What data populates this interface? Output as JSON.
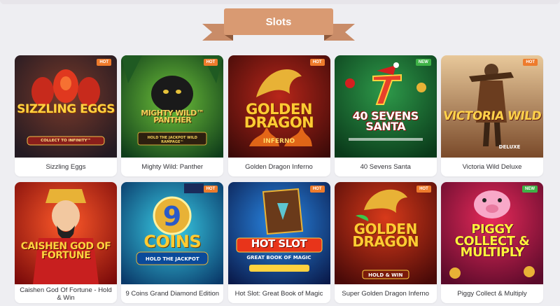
{
  "section": {
    "title": "Slots"
  },
  "colors": {
    "hot": "#ee7b2c",
    "new": "#3fb247",
    "ribbon": "#d99a72"
  },
  "games": [
    {
      "name": "Sizzling Eggs",
      "badge": "HOT",
      "art_title": "SIZZLING EGGS",
      "art_subtitle": "COLLECT TO INFINITY™"
    },
    {
      "name": "Mighty Wild: Panther",
      "badge": "HOT",
      "art_title": "MIGHTY WILD™ PANTHER",
      "art_subtitle": "HOLD THE JACKPOT WILD RAMPAGE™"
    },
    {
      "name": "Golden Dragon Inferno",
      "badge": "HOT",
      "art_title": "GOLDEN DRAGON",
      "art_subtitle": "INFERNO"
    },
    {
      "name": "40 Sevens Santa",
      "badge": "NEW",
      "art_title": "40 SEVENS SANTA",
      "art_subtitle": ""
    },
    {
      "name": "Victoria Wild Deluxe",
      "badge": "HOT",
      "art_title": "VICTORIA WILD",
      "art_subtitle": "DELUXE"
    },
    {
      "name": "Caishen God Of Fortune - Hold & Win",
      "badge": "",
      "art_title": "CAISHEN GOD OF FORTUNE",
      "art_subtitle": ""
    },
    {
      "name": "9 Coins Grand Diamond Edition",
      "badge": "HOT",
      "art_title": "COINS",
      "art_subtitle": "HOLD THE JACKPOT"
    },
    {
      "name": "Hot Slot: Great Book of Magic",
      "badge": "HOT",
      "art_title": "HOT SLOT",
      "art_subtitle": "GREAT BOOK OF MAGIC"
    },
    {
      "name": "Super Golden Dragon Inferno",
      "badge": "HOT",
      "art_title": "GOLDEN DRAGON",
      "art_subtitle": "HOLD & WIN"
    },
    {
      "name": "Piggy Collect & Multiply",
      "badge": "NEW",
      "art_title": "PIGGY COLLECT & MULTIPLY",
      "art_subtitle": ""
    }
  ]
}
